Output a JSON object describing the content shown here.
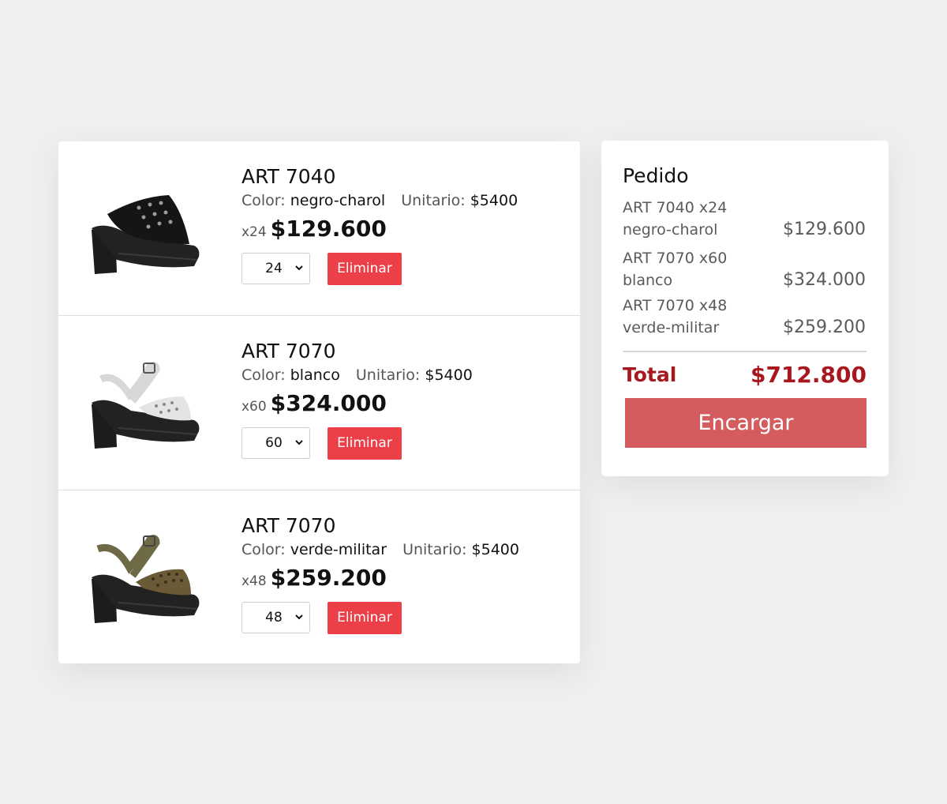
{
  "cart": {
    "items": [
      {
        "name": "ART 7040",
        "color_label": "Color:",
        "color": "negro-charol",
        "unit_label": "Unitario:",
        "unit_price": "$5400",
        "qty_text": "x24",
        "subtotal": "$129.600",
        "selected_qty": "24",
        "remove_label": "Eliminar",
        "image_icon": "black-patent-studded-platform-sandal",
        "upper_color": "#151515",
        "strap_color": "#151515"
      },
      {
        "name": "ART 7070",
        "color_label": "Color:",
        "color": "blanco",
        "unit_label": "Unitario:",
        "unit_price": "$5400",
        "qty_text": "x60",
        "subtotal": "$324.000",
        "selected_qty": "60",
        "remove_label": "Eliminar",
        "image_icon": "white-studded-platform-sandal",
        "upper_color": "#e4e4e2",
        "strap_color": "#d8d8d6"
      },
      {
        "name": "ART 7070",
        "color_label": "Color:",
        "color": "verde-militar",
        "unit_label": "Unitario:",
        "unit_price": "$5400",
        "qty_text": "x48",
        "subtotal": "$259.200",
        "selected_qty": "48",
        "remove_label": "Eliminar",
        "image_icon": "olive-studded-platform-sandal",
        "upper_color": "#6a5a36",
        "strap_color": "#6e6a45"
      }
    ]
  },
  "summary": {
    "title": "Pedido",
    "lines": [
      {
        "line1": "ART 7040 x24",
        "line2": "negro-charol",
        "amount": "$129.600"
      },
      {
        "line1": "ART 7070 x60",
        "line2": "blanco",
        "amount": "$324.000"
      },
      {
        "line1": "ART 7070 x48",
        "line2": "verde-militar",
        "amount": "$259.200"
      }
    ],
    "total_label": "Total",
    "total_value": "$712.800",
    "order_button": "Encargar"
  },
  "colors": {
    "accent_red": "#ec3f47",
    "total_red": "#a8171d",
    "order_button": "#d45c5f",
    "background": "#efefef"
  }
}
